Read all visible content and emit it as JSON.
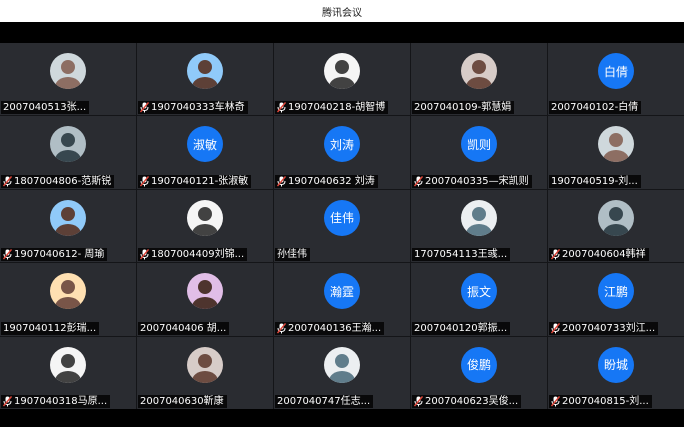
{
  "window": {
    "title": "腾讯会议"
  },
  "participants": [
    {
      "name": "2007040513张...",
      "avatar_type": "photo",
      "muted": false
    },
    {
      "name": "1907040333车林奇",
      "avatar_type": "photo",
      "muted": true
    },
    {
      "name": "1907040218-胡智博",
      "avatar_type": "photo",
      "muted": true
    },
    {
      "name": "2007040109-郭慧娟",
      "avatar_type": "photo",
      "muted": false
    },
    {
      "name": "2007040102-白倩",
      "avatar_type": "text",
      "avatar_text": "白倩",
      "muted": false
    },
    {
      "name": "1807004806-范斯锐",
      "avatar_type": "photo",
      "muted": true
    },
    {
      "name": "1907040121-张淑敏",
      "avatar_type": "text",
      "avatar_text": "淑敏",
      "muted": true
    },
    {
      "name": "1907040632 刘涛",
      "avatar_type": "text",
      "avatar_text": "刘涛",
      "muted": true
    },
    {
      "name": "2007040335—宋凯则",
      "avatar_type": "text",
      "avatar_text": "凯则",
      "muted": true
    },
    {
      "name": "1907040519-刘...",
      "avatar_type": "photo",
      "muted": false
    },
    {
      "name": "1907040612- 周瑜",
      "avatar_type": "photo",
      "muted": true
    },
    {
      "name": "1807004409刘锦...",
      "avatar_type": "photo",
      "muted": true
    },
    {
      "name": "孙佳伟",
      "avatar_type": "text",
      "avatar_text": "佳伟",
      "muted": false
    },
    {
      "name": "1707054113王彧...",
      "avatar_type": "photo",
      "muted": false
    },
    {
      "name": "2007040604韩祥",
      "avatar_type": "photo",
      "muted": true
    },
    {
      "name": "1907040112彭瑞...",
      "avatar_type": "photo",
      "muted": false
    },
    {
      "name": "2007040406 胡...",
      "avatar_type": "photo",
      "muted": false
    },
    {
      "name": "2007040136王瀚...",
      "avatar_type": "text",
      "avatar_text": "瀚霆",
      "muted": true
    },
    {
      "name": "2007040120郭振...",
      "avatar_type": "text",
      "avatar_text": "振文",
      "muted": false
    },
    {
      "name": "2007040733刘江...",
      "avatar_type": "text",
      "avatar_text": "江鹏",
      "muted": true
    },
    {
      "name": "1907040318马原...",
      "avatar_type": "photo",
      "muted": true
    },
    {
      "name": "2007040630靳康",
      "avatar_type": "photo",
      "muted": false
    },
    {
      "name": "2007040747任志...",
      "avatar_type": "photo",
      "muted": false
    },
    {
      "name": "2007040623吴俊...",
      "avatar_type": "text",
      "avatar_text": "俊鹏",
      "muted": true
    },
    {
      "name": "2007040815-刘...",
      "avatar_type": "text",
      "avatar_text": "盼城",
      "muted": true
    }
  ],
  "colors": {
    "tile_bg": "#2a2c31",
    "grid_gap": "#141518",
    "text_avatar": "#1677f5",
    "muted_icon": "#e0463a"
  }
}
